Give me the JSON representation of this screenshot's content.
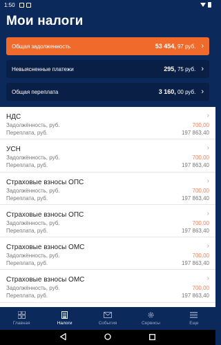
{
  "status": {
    "time": "1:50"
  },
  "header": {
    "title": "Мои налоги"
  },
  "summary": {
    "debt": {
      "label": "Общая задолженность",
      "amount": "53 454,",
      "cents": "97 руб."
    },
    "unknown": {
      "label": "Невыясненные платежи",
      "amount": "295,",
      "cents": "75 руб."
    },
    "overpay": {
      "label": "Общая переплата",
      "amount": "3 160,",
      "cents": "00 руб."
    }
  },
  "taxes": [
    {
      "name": "НДС",
      "debt_label": "Задолжённость, руб.",
      "debt": "700,00",
      "over_label": "Переплата, руб.",
      "over": "197 863,40"
    },
    {
      "name": "УСН",
      "debt_label": "Задолжённость, руб.",
      "debt": "700,00",
      "over_label": "Переплата, руб.",
      "over": "197 863,40"
    },
    {
      "name": "Страховые взносы ОПС",
      "debt_label": "Задолжённость, руб.",
      "debt": "700,00",
      "over_label": "Переплата, руб.",
      "over": "197 863,40"
    },
    {
      "name": "Страховые взносы ОПС",
      "debt_label": "Задолжённость, руб.",
      "debt": "700,00",
      "over_label": "Переплата, руб.",
      "over": "197 863,40"
    },
    {
      "name": "Страховые взносы ОМС",
      "debt_label": "Задолжённость, руб.",
      "debt": "700,00",
      "over_label": "Переплата, руб.",
      "over": "197 863,40"
    },
    {
      "name": "Страховые взносы ОМС",
      "debt_label": "Задолжённость, руб.",
      "debt": "700,00",
      "over_label": "Переплата, руб.",
      "over": "197 863,40"
    }
  ],
  "nav": {
    "home": "Главная",
    "taxes": "Налоги",
    "events": "События",
    "services": "Сервисы",
    "more": "Еще"
  },
  "colors": {
    "accent": "#f06a2c",
    "brand": "#0b2a5b"
  }
}
